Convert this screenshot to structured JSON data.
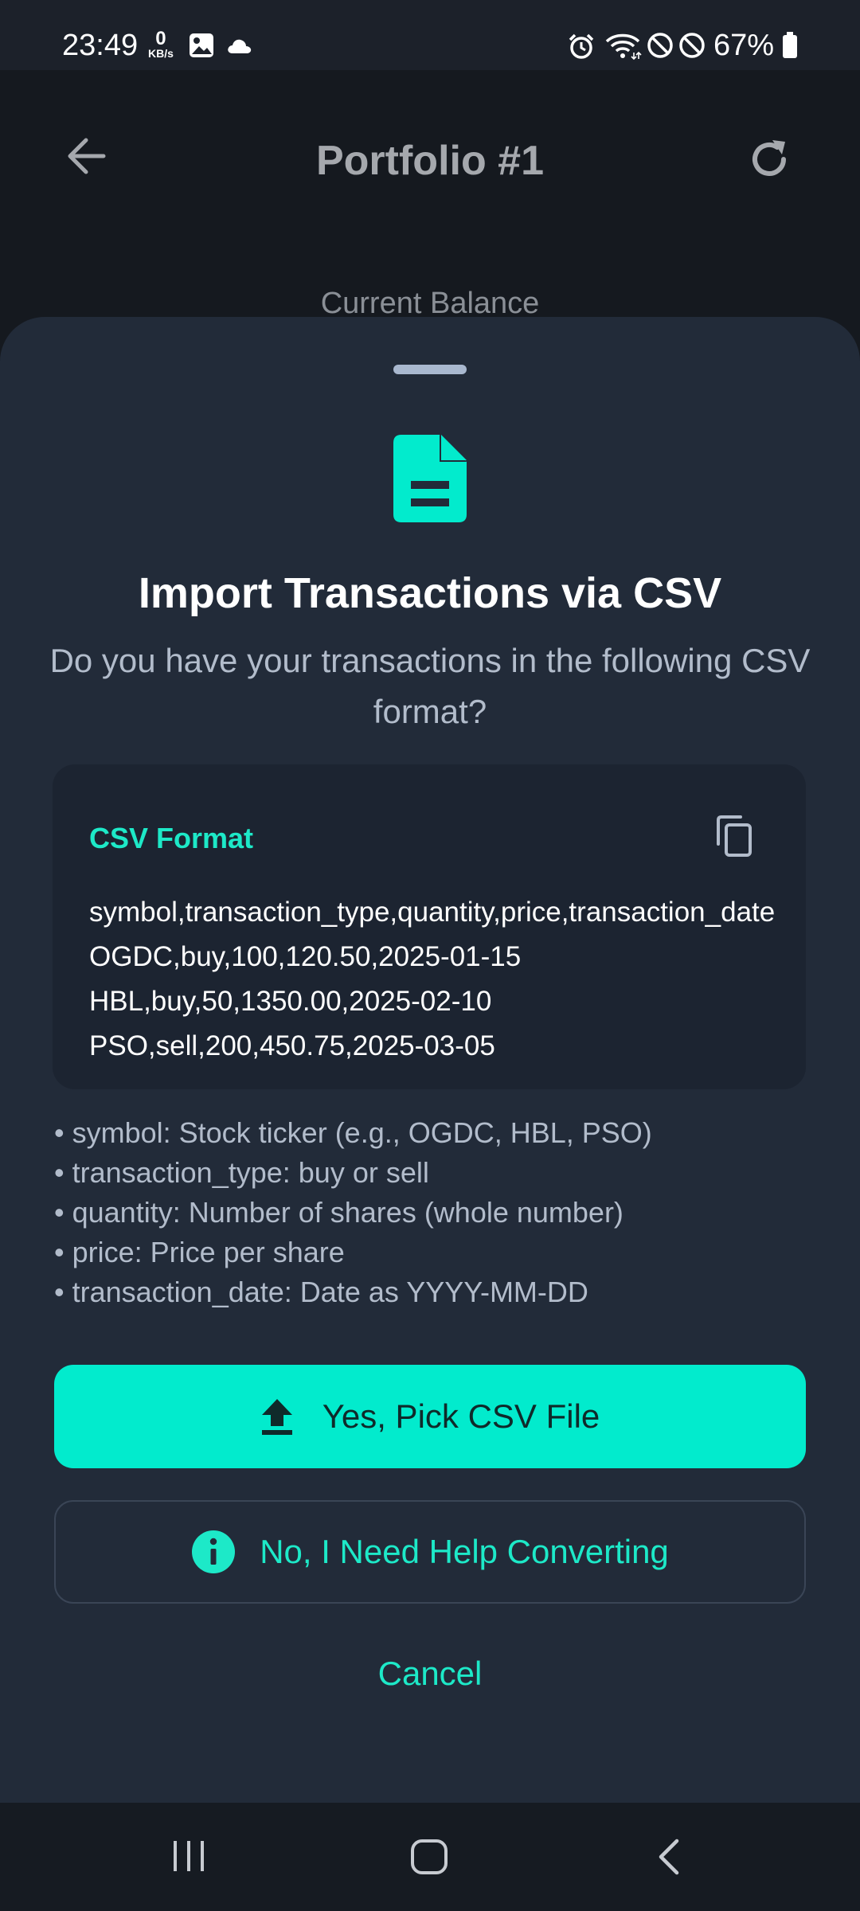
{
  "status_bar": {
    "time": "23:49",
    "net_speed_value": "0",
    "net_speed_unit": "KB/s",
    "battery": "67%",
    "icons": [
      "gallery-icon",
      "cloud-icon",
      "alarm-icon",
      "wifi-icon",
      "dnd-icon",
      "block-icon",
      "battery-icon"
    ]
  },
  "app_bar": {
    "title": "Portfolio #1",
    "balance_label": "Current Balance"
  },
  "sheet": {
    "title": "Import Transactions via CSV",
    "subtitle": "Do you have your transactions in the following CSV format?",
    "csv_card": {
      "title": "CSV Format",
      "lines": [
        "symbol,transaction_type,quantity,price,transaction_date",
        "OGDC,buy,100,120.50,2025-01-15",
        "HBL,buy,50,1350.00,2025-02-10",
        "PSO,sell,200,450.75,2025-03-05"
      ]
    },
    "fields": [
      "• symbol: Stock ticker (e.g., OGDC, HBL, PSO)",
      "• transaction_type: buy or sell",
      "• quantity: Number of shares (whole number)",
      "• price: Price per share",
      "• transaction_date: Date as YYYY-MM-DD"
    ],
    "primary_button": "Yes, Pick CSV File",
    "secondary_button": "No, I Need Help Converting",
    "cancel_button": "Cancel"
  },
  "colors": {
    "accent": "#02ebcd",
    "sheet_bg": "#222b39",
    "card_bg": "#1c2431",
    "page_bg": "#15191f"
  }
}
